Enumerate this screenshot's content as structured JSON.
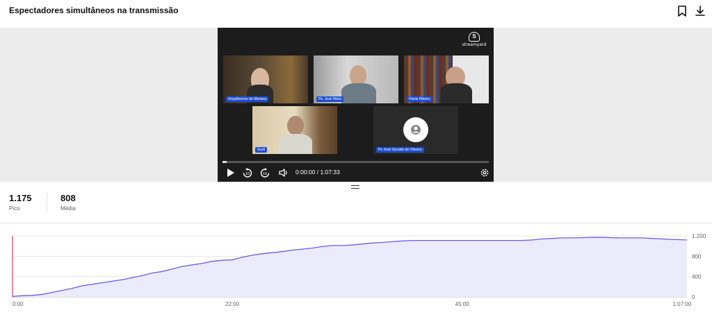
{
  "header": {
    "title": "Espectadores simultâneos na transmissão",
    "bookmark_icon": "bookmark-icon",
    "download_icon": "download-icon"
  },
  "player": {
    "brand": "streamyard",
    "participants": [
      {
        "name": "Arquidiocese de Mariana"
      },
      {
        "name": "Pe. José Mário"
      },
      {
        "name": "Flávia Ribeiro"
      },
      {
        "name": "Sueli"
      },
      {
        "name": "Pe José Geraldo de Oliveira"
      }
    ],
    "time": "0:00:00 / 1:07:33",
    "controls": [
      "play-icon",
      "rewind-10-icon",
      "forward-10-icon",
      "volume-icon",
      "settings-icon"
    ]
  },
  "stats": {
    "peak_value": "1.175",
    "peak_label": "Pico",
    "avg_value": "808",
    "avg_label": "Média"
  },
  "chart_data": {
    "type": "area",
    "title": "",
    "xlabel": "",
    "ylabel": "",
    "x_tick_labels": [
      "0:00",
      "22:00",
      "45:00",
      "1:07:00"
    ],
    "y_tick_labels": [
      "0",
      "400",
      "800",
      "1.200"
    ],
    "ylim": [
      0,
      1200
    ],
    "xlim_minutes": [
      0,
      67.5
    ],
    "y_axis_position": "right",
    "grid": true,
    "colors": {
      "line": "#6a5ae0",
      "fill": "#ecebfb",
      "marker": "#e0405a"
    },
    "series": [
      {
        "x_minutes": [
          0,
          1,
          2,
          3,
          4,
          5,
          6,
          7,
          8,
          9,
          10,
          11,
          12,
          13,
          14,
          15,
          16,
          17,
          18,
          19,
          20,
          21,
          22,
          23,
          24,
          25,
          26,
          27,
          28,
          29,
          30,
          31,
          32,
          33,
          34,
          35,
          36,
          37,
          38,
          39,
          40,
          41,
          42,
          43,
          44,
          45,
          46,
          47,
          48,
          49,
          50,
          51,
          52,
          53,
          54,
          55,
          56,
          57,
          58,
          59,
          60,
          61,
          62,
          63,
          64,
          65,
          66,
          67.5
        ],
        "values": [
          10,
          25,
          30,
          50,
          90,
          130,
          170,
          220,
          250,
          280,
          310,
          340,
          380,
          420,
          470,
          500,
          550,
          600,
          630,
          660,
          700,
          720,
          730,
          780,
          820,
          850,
          870,
          890,
          920,
          940,
          960,
          990,
          1010,
          1010,
          1020,
          1040,
          1060,
          1070,
          1085,
          1100,
          1110,
          1110,
          1110,
          1110,
          1110,
          1110,
          1110,
          1110,
          1110,
          1110,
          1110,
          1110,
          1120,
          1140,
          1150,
          1160,
          1160,
          1165,
          1170,
          1170,
          1165,
          1160,
          1160,
          1160,
          1150,
          1140,
          1130,
          1120
        ]
      }
    ]
  }
}
